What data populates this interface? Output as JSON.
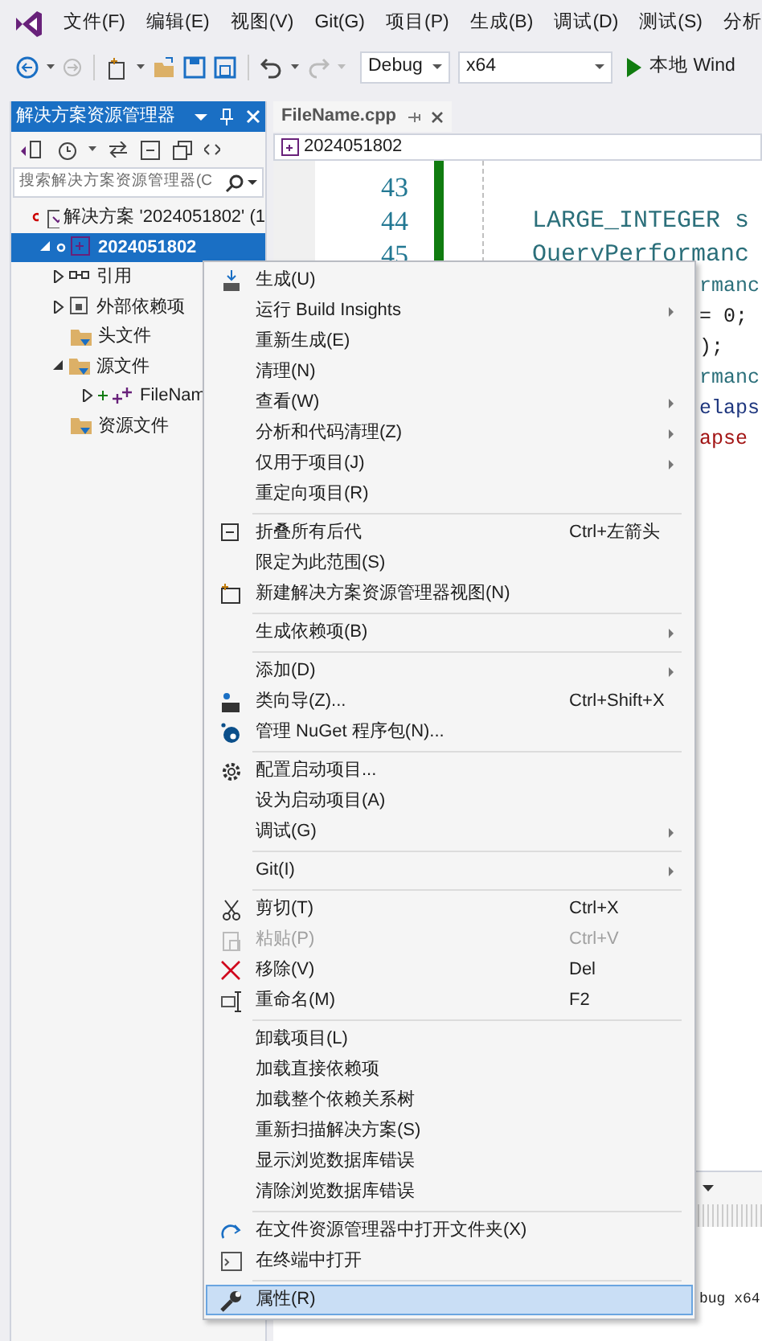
{
  "menu_bar": [
    {
      "label": "文件(F)"
    },
    {
      "label": "编辑(E)"
    },
    {
      "label": "视图(V)"
    },
    {
      "label": "Git(G)"
    },
    {
      "label": "项目(P)"
    },
    {
      "label": "生成(B)"
    },
    {
      "label": "调试(D)"
    },
    {
      "label": "测试(S)"
    },
    {
      "label": "分析"
    }
  ],
  "toolbar": {
    "configuration": "Debug",
    "platform": "x64",
    "run_label": "本地 Wind"
  },
  "solution_explorer": {
    "title": "解决方案资源管理器",
    "search": {
      "placeholder": "搜索解决方案资源管理器(C"
    },
    "tree": [
      {
        "label": "解决方案 '2024051802' (1",
        "selected": false,
        "children": [
          {
            "label": "2024051802",
            "selected": true,
            "expanded": true,
            "children": [
              {
                "label": "引用",
                "selected": false,
                "expanded": false
              },
              {
                "label": "外部依赖项",
                "selected": false,
                "expanded": false
              },
              {
                "label": "头文件",
                "selected": false
              },
              {
                "label": "源文件",
                "selected": false,
                "expanded": true,
                "children": [
                  {
                    "label": "FileNam",
                    "selected": false,
                    "expanded": false
                  }
                ]
              },
              {
                "label": "资源文件",
                "selected": false
              }
            ]
          }
        ]
      }
    ]
  },
  "editor": {
    "tabs": [
      {
        "label": "FileName.cpp",
        "selected": true
      }
    ],
    "breadcrumb": "2024051802",
    "lines": [
      {
        "number": "43"
      },
      {
        "number": "44",
        "code": "LARGE_INTEGER s"
      },
      {
        "number": "45",
        "code": "QueryPerformanc"
      }
    ],
    "code_fragments": [
      {
        "text": "rmanc",
        "color": "#2b6f7a"
      },
      {
        "text": "= 0;",
        "color": "#1e1e1e"
      },
      {
        "text": ");",
        "color": "#1e1e1e"
      },
      {
        "text": "rmanc",
        "color": "#2b6f7a"
      },
      {
        "text": "elaps",
        "color": "#1f377f"
      },
      {
        "text": "apse",
        "color": "#a31515"
      }
    ]
  },
  "output": {
    "lines": [
      "bug x64"
    ]
  },
  "context_menu": {
    "items": [
      {
        "kind": "item",
        "label": "生成(U)"
      },
      {
        "kind": "item",
        "label": "运行 Build Insights",
        "submenu": true
      },
      {
        "kind": "item",
        "label": "重新生成(E)"
      },
      {
        "kind": "item",
        "label": "清理(N)"
      },
      {
        "kind": "item",
        "label": "查看(W)",
        "submenu": true
      },
      {
        "kind": "item",
        "label": "分析和代码清理(Z)",
        "submenu": true
      },
      {
        "kind": "item",
        "label": "仅用于项目(J)",
        "submenu": true
      },
      {
        "kind": "item",
        "label": "重定向项目(R)"
      },
      {
        "kind": "separator"
      },
      {
        "kind": "item",
        "label": "折叠所有后代",
        "shortcut": "Ctrl+左箭头"
      },
      {
        "kind": "item",
        "label": "限定为此范围(S)"
      },
      {
        "kind": "item",
        "label": "新建解决方案资源管理器视图(N)"
      },
      {
        "kind": "separator"
      },
      {
        "kind": "item",
        "label": "生成依赖项(B)",
        "submenu": true
      },
      {
        "kind": "separator"
      },
      {
        "kind": "item",
        "label": "添加(D)",
        "submenu": true
      },
      {
        "kind": "item",
        "label": "类向导(Z)...",
        "shortcut": "Ctrl+Shift+X"
      },
      {
        "kind": "item",
        "label": "管理 NuGet 程序包(N)..."
      },
      {
        "kind": "separator"
      },
      {
        "kind": "item",
        "label": "配置启动项目..."
      },
      {
        "kind": "item",
        "label": "设为启动项目(A)"
      },
      {
        "kind": "item",
        "label": "调试(G)",
        "submenu": true
      },
      {
        "kind": "separator"
      },
      {
        "kind": "item",
        "label": "Git(I)",
        "submenu": true
      },
      {
        "kind": "separator"
      },
      {
        "kind": "item",
        "label": "剪切(T)",
        "shortcut": "Ctrl+X"
      },
      {
        "kind": "item",
        "label": "粘贴(P)",
        "shortcut": "Ctrl+V",
        "disabled": true
      },
      {
        "kind": "item",
        "label": "移除(V)",
        "shortcut": "Del"
      },
      {
        "kind": "item",
        "label": "重命名(M)",
        "shortcut": "F2"
      },
      {
        "kind": "separator"
      },
      {
        "kind": "item",
        "label": "卸载项目(L)"
      },
      {
        "kind": "item",
        "label": "加载直接依赖项"
      },
      {
        "kind": "item",
        "label": "加载整个依赖关系树"
      },
      {
        "kind": "item",
        "label": "重新扫描解决方案(S)"
      },
      {
        "kind": "item",
        "label": "显示浏览数据库错误"
      },
      {
        "kind": "item",
        "label": "清除浏览数据库错误"
      },
      {
        "kind": "separator"
      },
      {
        "kind": "item",
        "label": "在文件资源管理器中打开文件夹(X)"
      },
      {
        "kind": "item",
        "label": "在终端中打开"
      },
      {
        "kind": "separator"
      },
      {
        "kind": "item",
        "label": "属性(R)",
        "selected": true
      }
    ]
  }
}
